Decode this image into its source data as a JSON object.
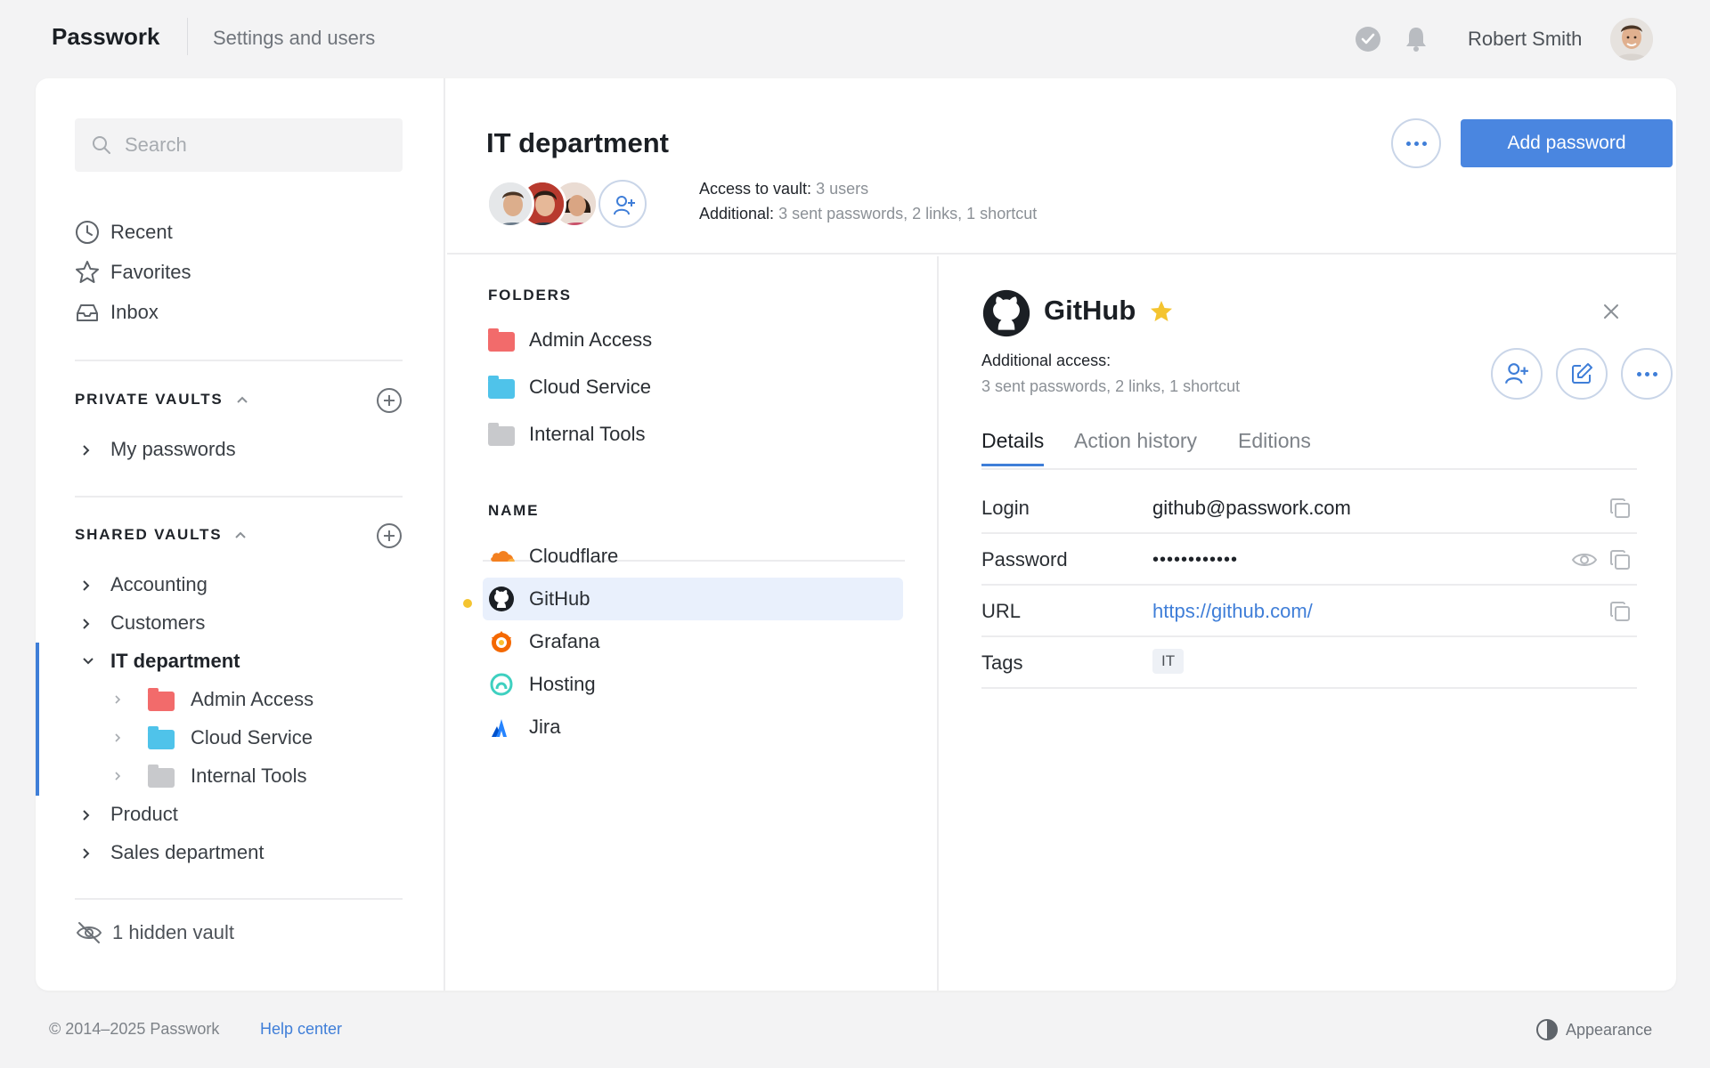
{
  "app": {
    "brand": "Passwork",
    "top_link": "Settings and users",
    "user_name": "Robert Smith"
  },
  "sidebar": {
    "search_placeholder": "Search",
    "nav": [
      {
        "label": "Recent",
        "icon": "clock-icon"
      },
      {
        "label": "Favorites",
        "icon": "star-icon"
      },
      {
        "label": "Inbox",
        "icon": "inbox-icon"
      }
    ],
    "private_vaults": {
      "title": "PRIVATE VAULTS",
      "items": [
        "My passwords"
      ]
    },
    "shared_vaults": {
      "title": "SHARED VAULTS",
      "items": [
        "Accounting",
        "Customers",
        "IT department",
        "Product",
        "Sales department"
      ],
      "it_children": [
        {
          "label": "Admin Access",
          "color": "#f26b6b"
        },
        {
          "label": "Cloud Service",
          "color": "#4fc3ea"
        },
        {
          "label": "Internal Tools",
          "color": "#c8c9cc"
        }
      ]
    },
    "hidden_vault": "1 hidden vault"
  },
  "vault": {
    "title": "IT department",
    "access_label": "Access to vault:",
    "access_value": "3 users",
    "additional_label": "Additional:",
    "additional_value": "3 sent passwords, 2 links, 1 shortcut",
    "add_password": "Add password"
  },
  "list": {
    "folders_heading": "FOLDERS",
    "folders": [
      {
        "label": "Admin Access",
        "color": "#f26b6b"
      },
      {
        "label": "Cloud Service",
        "color": "#4fc3ea"
      },
      {
        "label": "Internal Tools",
        "color": "#c8c9cc"
      }
    ],
    "name_heading": "NAME",
    "items": [
      "Cloudflare",
      "GitHub",
      "Grafana",
      "Hosting",
      "Jira"
    ]
  },
  "detail": {
    "title": "GitHub",
    "additional_access_label": "Additional access:",
    "additional_access_value": "3 sent passwords, 2 links, 1 shortcut",
    "tabs": [
      "Details",
      "Action history",
      "Editions"
    ],
    "fields": {
      "login_label": "Login",
      "login_value": "github@passwork.com",
      "password_label": "Password",
      "password_value": "••••••••••••",
      "url_label": "URL",
      "url_value": "https://github.com/",
      "tags_label": "Tags",
      "tag_value": "IT"
    }
  },
  "footer": {
    "copyright": "© 2014–2025 Passwork",
    "help": "Help center",
    "appearance": "Appearance"
  },
  "colors": {
    "accent": "#4a86e0",
    "favorite": "#f4c430",
    "selected_row": "#e9f0fc"
  }
}
